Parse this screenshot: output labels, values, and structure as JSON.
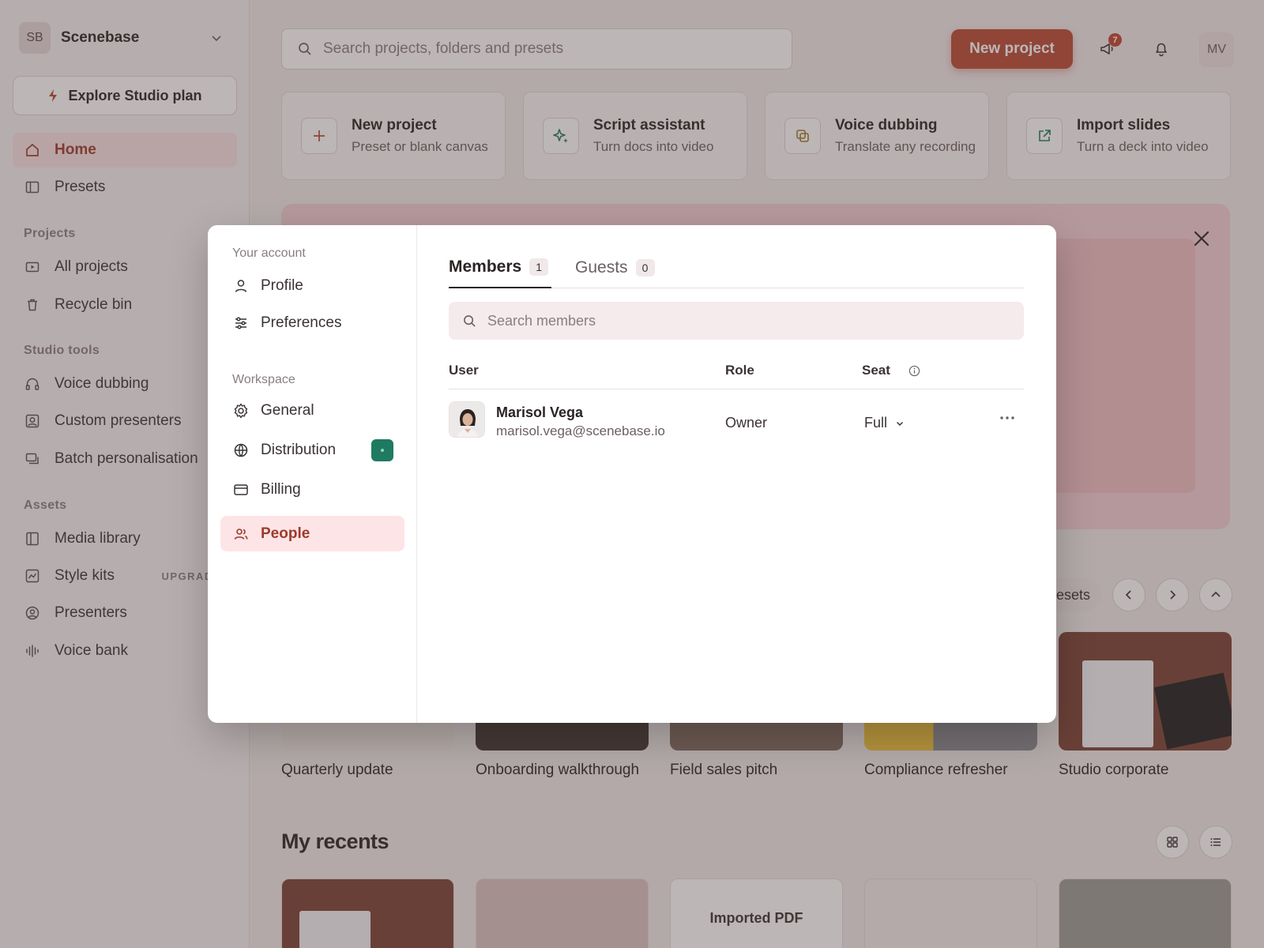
{
  "sidebar": {
    "workspace_initials": "SB",
    "workspace_name": "Scenebase",
    "explore_label": "Explore Studio plan",
    "home": "Home",
    "presets": "Presets",
    "sections": {
      "projects": "Projects",
      "studio_tools": "Studio tools",
      "assets": "Assets"
    },
    "projects_items": [
      "All projects",
      "Recycle bin"
    ],
    "studio_items": [
      "Voice dubbing",
      "Custom presenters",
      "Batch personalisation"
    ],
    "assets_items": [
      "Media library",
      "Style kits",
      "Presenters",
      "Voice bank"
    ],
    "upgrade_label": "UPGRADE"
  },
  "header": {
    "search_placeholder": "Search projects, folders and presets",
    "new_project_label": "New project",
    "announcements_count": "7",
    "user_initials": "MV"
  },
  "quick_actions": [
    {
      "title": "New project",
      "subtitle": "Preset or blank canvas",
      "icon": "plus-icon"
    },
    {
      "title": "Script assistant",
      "subtitle": "Turn docs into video",
      "icon": "sparkle-icon"
    },
    {
      "title": "Voice dubbing",
      "subtitle": "Translate any recording",
      "icon": "copy-icon"
    },
    {
      "title": "Import slides",
      "subtitle": "Turn a deck into video",
      "icon": "external-link-icon"
    }
  ],
  "presets_row": {
    "pill_label": "Presets",
    "cards": [
      "Quarterly update",
      "Onboarding walkthrough",
      "Field sales pitch",
      "Compliance refresher",
      "Studio corporate"
    ]
  },
  "recents": {
    "title": "My recents",
    "pdf_label": "Imported PDF"
  },
  "modal": {
    "account_section": "Your account",
    "account_items": [
      "Profile",
      "Preferences"
    ],
    "workspace_section": "Workspace",
    "workspace_items": [
      "General",
      "Distribution",
      "Billing",
      "People"
    ],
    "tabs": [
      {
        "label": "Members",
        "count": "1"
      },
      {
        "label": "Guests",
        "count": "0"
      }
    ],
    "search_placeholder": "Search members",
    "columns": {
      "user": "User",
      "role": "Role",
      "seat": "Seat"
    },
    "members": [
      {
        "name": "Marisol Vega",
        "email": "marisol.vega@scenebase.io",
        "role": "Owner",
        "seat": "Full"
      }
    ]
  },
  "colors": {
    "accent": "#b84a33",
    "active_nav": "#9c3b2b",
    "distribution_badge": "#1f7a62"
  }
}
